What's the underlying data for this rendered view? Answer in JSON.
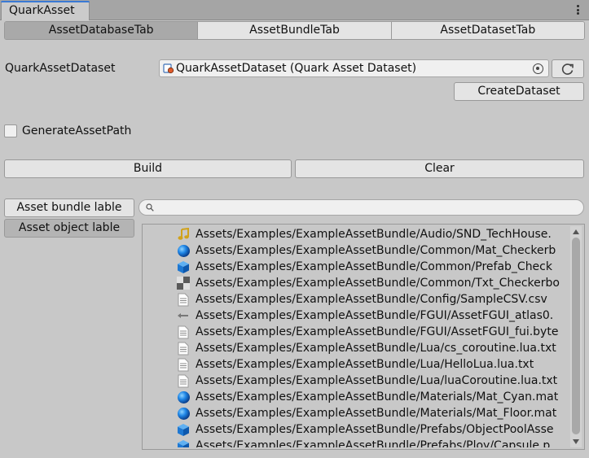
{
  "window": {
    "tab_title": "QuarkAsset"
  },
  "tabs": [
    {
      "label": "AssetDatabaseTab",
      "active": true
    },
    {
      "label": "AssetBundleTab",
      "active": false
    },
    {
      "label": "AssetDatasetTab",
      "active": false
    }
  ],
  "dataset": {
    "label": "QuarkAssetDataset",
    "value": "QuarkAssetDataset (Quark Asset Dataset)",
    "create_button": "CreateDataset"
  },
  "generate_asset_path": {
    "label": "GenerateAssetPath",
    "checked": false
  },
  "actions": {
    "build": "Build",
    "clear": "Clear"
  },
  "side_buttons": {
    "bundle_label": "Asset bundle lable",
    "object_label": "Asset object lable"
  },
  "search": {
    "placeholder": ""
  },
  "assets": [
    {
      "icon": "audio-icon",
      "path": "Assets/Examples/ExampleAssetBundle/Audio/SND_TechHouse."
    },
    {
      "icon": "material-icon",
      "path": "Assets/Examples/ExampleAssetBundle/Common/Mat_Checkerb"
    },
    {
      "icon": "prefab-icon",
      "path": "Assets/Examples/ExampleAssetBundle/Common/Prefab_Check"
    },
    {
      "icon": "texture-icon",
      "path": "Assets/Examples/ExampleAssetBundle/Common/Txt_Checkerbo"
    },
    {
      "icon": "text-file-icon",
      "path": "Assets/Examples/ExampleAssetBundle/Config/SampleCSV.csv"
    },
    {
      "icon": "atlas-icon",
      "path": "Assets/Examples/ExampleAssetBundle/FGUI/AssetFGUI_atlas0."
    },
    {
      "icon": "text-file-icon",
      "path": "Assets/Examples/ExampleAssetBundle/FGUI/AssetFGUI_fui.byte"
    },
    {
      "icon": "text-file-icon",
      "path": "Assets/Examples/ExampleAssetBundle/Lua/cs_coroutine.lua.txt"
    },
    {
      "icon": "text-file-icon",
      "path": "Assets/Examples/ExampleAssetBundle/Lua/HelloLua.lua.txt"
    },
    {
      "icon": "text-file-icon",
      "path": "Assets/Examples/ExampleAssetBundle/Lua/luaCoroutine.lua.txt"
    },
    {
      "icon": "material-icon",
      "path": "Assets/Examples/ExampleAssetBundle/Materials/Mat_Cyan.mat"
    },
    {
      "icon": "material-icon",
      "path": "Assets/Examples/ExampleAssetBundle/Materials/Mat_Floor.mat"
    },
    {
      "icon": "prefab-icon",
      "path": "Assets/Examples/ExampleAssetBundle/Prefabs/ObjectPoolAsse"
    },
    {
      "icon": "prefab-icon",
      "path": "Assets/Examples/ExampleAssetBundle/Prefabs/Ploy/Capsule.p"
    }
  ]
}
